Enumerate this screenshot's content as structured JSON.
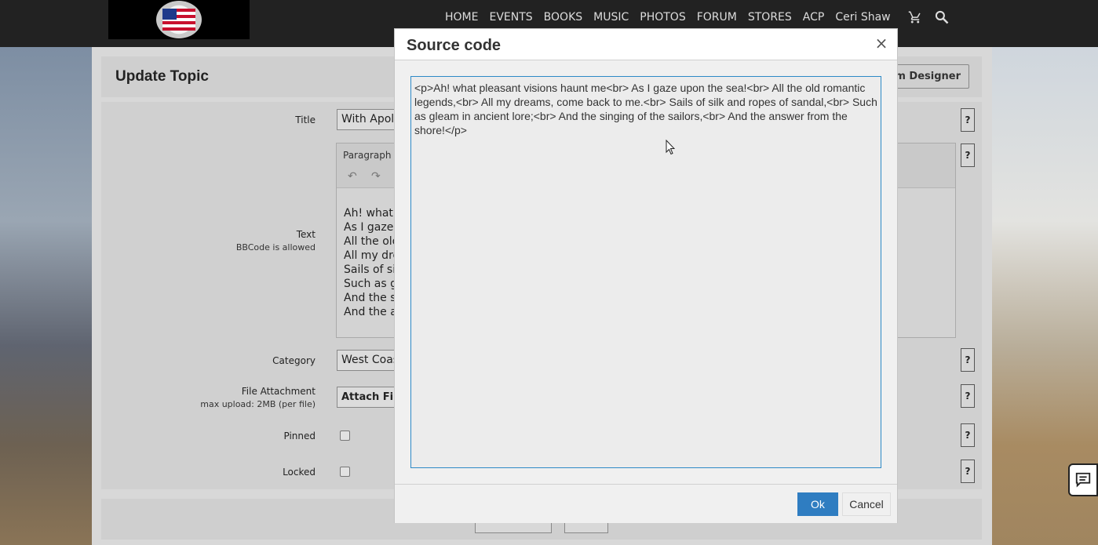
{
  "nav": {
    "items": [
      "HOME",
      "EVENTS",
      "BOOKS",
      "MUSIC",
      "PHOTOS",
      "FORUM",
      "STORES",
      "ACP",
      "Ceri Shaw"
    ],
    "icons": [
      "cart-icon",
      "search-icon"
    ]
  },
  "page": {
    "title": "Update Topic",
    "form_designer_label": "orm Designer",
    "fields": {
      "title_label": "Title",
      "title_value": "With Apolog",
      "text_label": "Text",
      "text_sub": "BBCode is allowed",
      "editor_format": "Paragraph",
      "editor_lines": [
        "Ah! what p",
        "As I gaze u",
        "All the old",
        "All my drea",
        "Sails of silk",
        "Such as gle",
        "And the sin",
        "And the an"
      ],
      "category_label": "Category",
      "category_value": "West Coast E",
      "file_label": "File Attachment",
      "file_sub": "max upload: 2MB (per file)",
      "attach_label": "Attach Files",
      "pinned_label": "Pinned",
      "locked_label": "Locked",
      "help": "?"
    }
  },
  "modal": {
    "title": "Source code",
    "close": "×",
    "source": "<p>Ah! what pleasant visions haunt me<br> As I gaze upon the sea!<br> All the old romantic legends,<br> All my dreams, come back to me.<br> Sails of silk and ropes of sandal,<br> Such as gleam in ancient lore;<br> And the singing of the sailors,<br> And the answer from the shore!</p>",
    "ok_label": "Ok",
    "cancel_label": "Cancel"
  },
  "colors": {
    "accent": "#2f7dc1",
    "navbar": "#222222"
  }
}
